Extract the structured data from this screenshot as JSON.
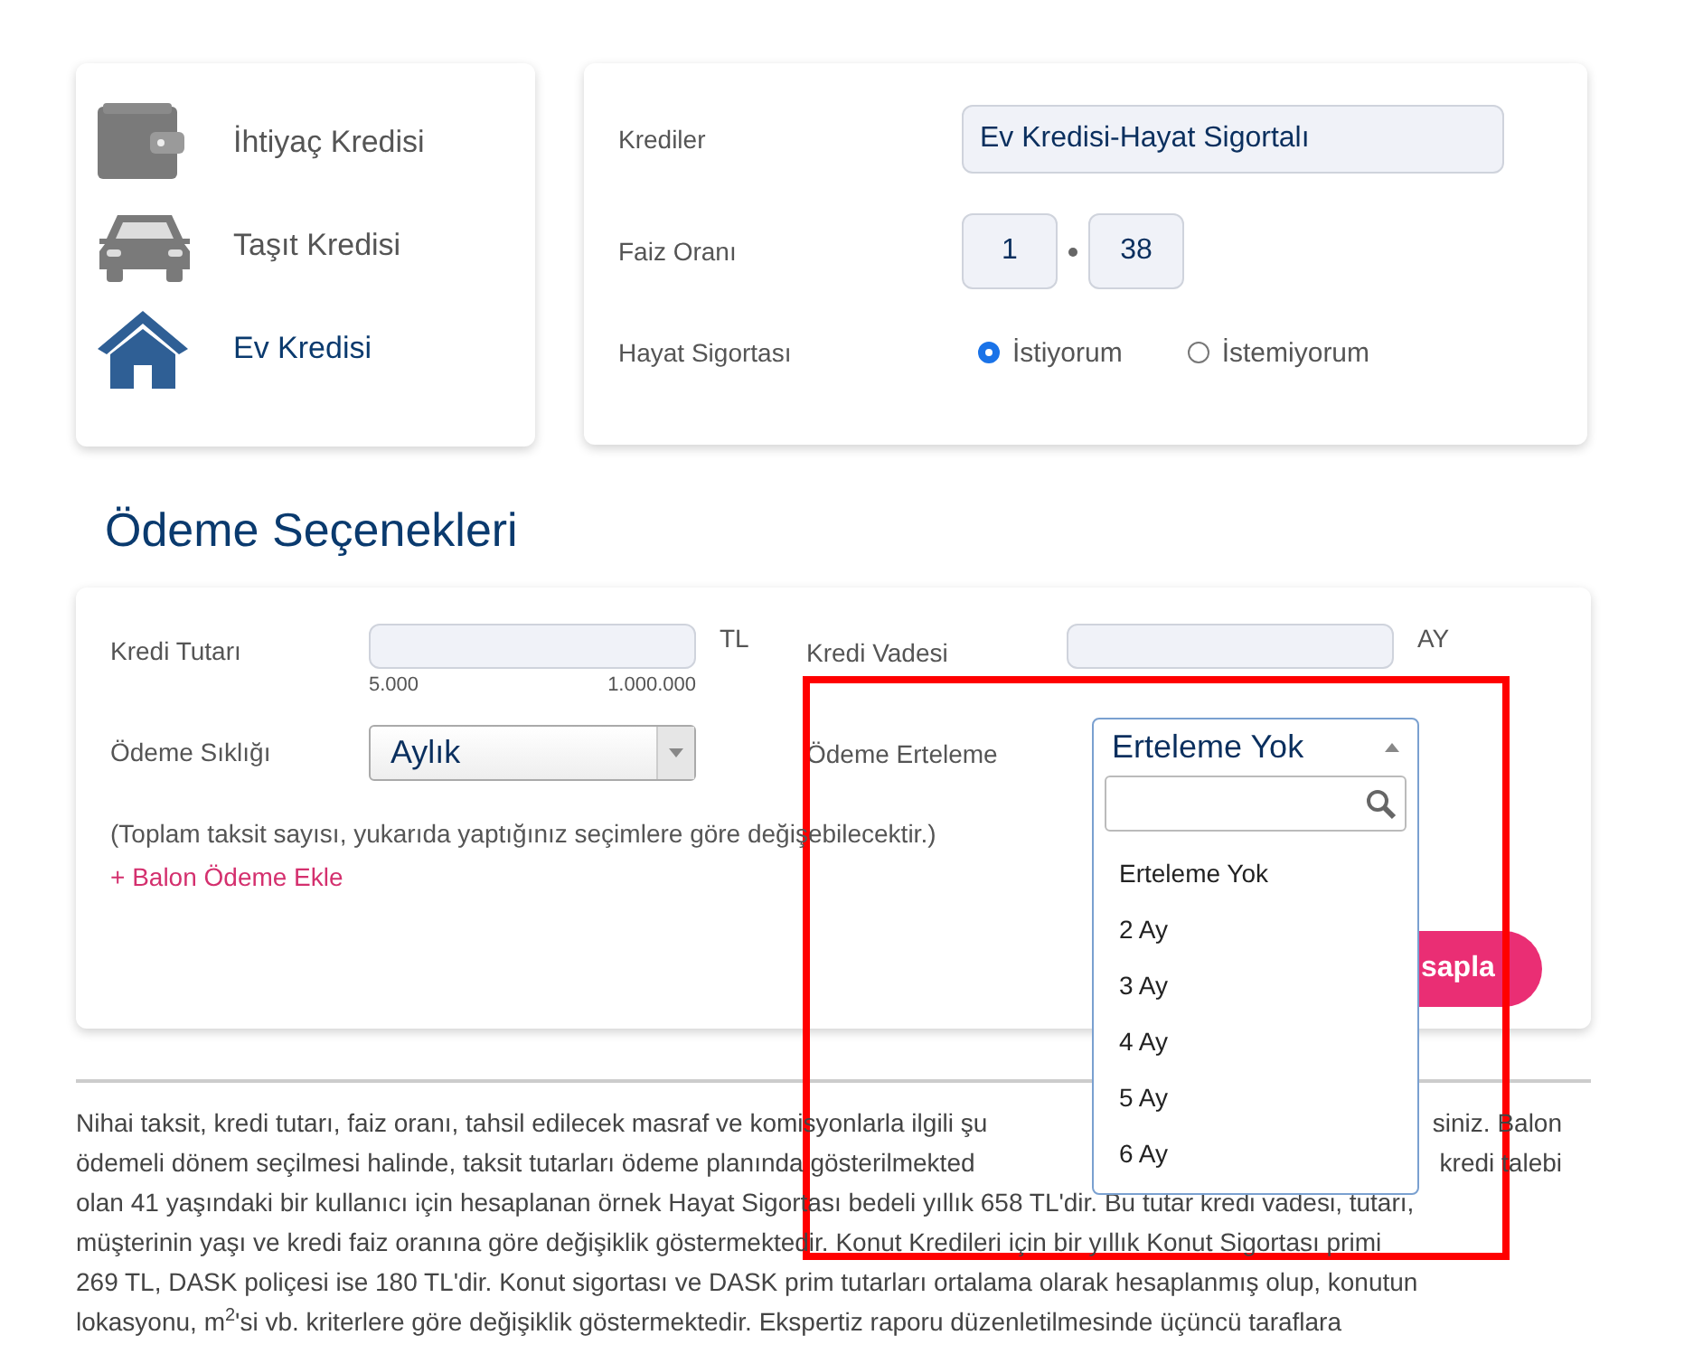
{
  "loan_types": [
    {
      "label": "İhtiyaç Kredisi",
      "kind": "wallet",
      "selected": false
    },
    {
      "label": "Taşıt Kredisi",
      "kind": "car",
      "selected": false
    },
    {
      "label": "Ev Kredisi",
      "kind": "house",
      "selected": true
    }
  ],
  "loan_form": {
    "credit": {
      "label": "Krediler",
      "value": "Ev Kredisi-Hayat Sigortalı"
    },
    "rate": {
      "label": "Faiz Oranı",
      "whole": "1",
      "fraction": "38"
    },
    "insurance": {
      "label": "Hayat Sigortası",
      "options": [
        {
          "label": "İstiyorum",
          "selected": true
        },
        {
          "label": "İstemiyorum",
          "selected": false
        }
      ]
    }
  },
  "section_title": "Ödeme Seçenekleri",
  "payment": {
    "amount": {
      "label": "Kredi Tutarı",
      "unit": "TL",
      "min": "5.000",
      "max": "1.000.000"
    },
    "term": {
      "label": "Kredi Vadesi",
      "unit": "AY"
    },
    "frequency": {
      "label": "Ödeme Sıklığı",
      "value": "Aylık"
    },
    "deferral": {
      "label": "Ödeme Erteleme",
      "value": "Erteleme Yok",
      "expanded": true,
      "options": [
        "Erteleme Yok",
        "2 Ay",
        "3 Ay",
        "4 Ay",
        "5 Ay",
        "6 Ay"
      ]
    },
    "note": "(Toplam taksit sayısı, yukarıda yaptığınız seçimlere göre değişebilecektir.)",
    "balloon_link": "+ Balon Ödeme Ekle",
    "calculate_button": "sapla"
  },
  "disclaimer_lines": [
    {
      "left": "Nihai taksit, kredi tutarı, faiz oranı, tahsil edilecek masraf ve komisyonlarla ilgili şu",
      "right": "siniz. Balon"
    },
    {
      "left": "ödemeli dönem seçilmesi halinde, taksit tutarları ödeme planında gösterilmekted",
      "right": "kredi talebi"
    },
    {
      "left": "olan 41 yaşındaki bir kullanıcı için hesaplanan örnek Hayat Sigortası bedeli yıllık 658 TL'dir. Bu tutar kredi vadesi, tutarı,"
    },
    {
      "left": "müşterinin yaşı ve kredi faiz oranına göre değişiklik göstermektedir. Konut Kredileri için bir yıllık Konut Sigortası primi"
    },
    {
      "left": "269 TL, DASK poliçesi ise 180 TL'dir. Konut sigortası ve DASK prim tutarları ortalama olarak hesaplanmış olup, konutun"
    },
    {
      "left": "lokasyonu, m$^{2}$'si vb. kriterlere göre değişiklik göstermektedir. Ekspertiz raporu düzenletilmesinde üçüncü taraflara"
    }
  ]
}
